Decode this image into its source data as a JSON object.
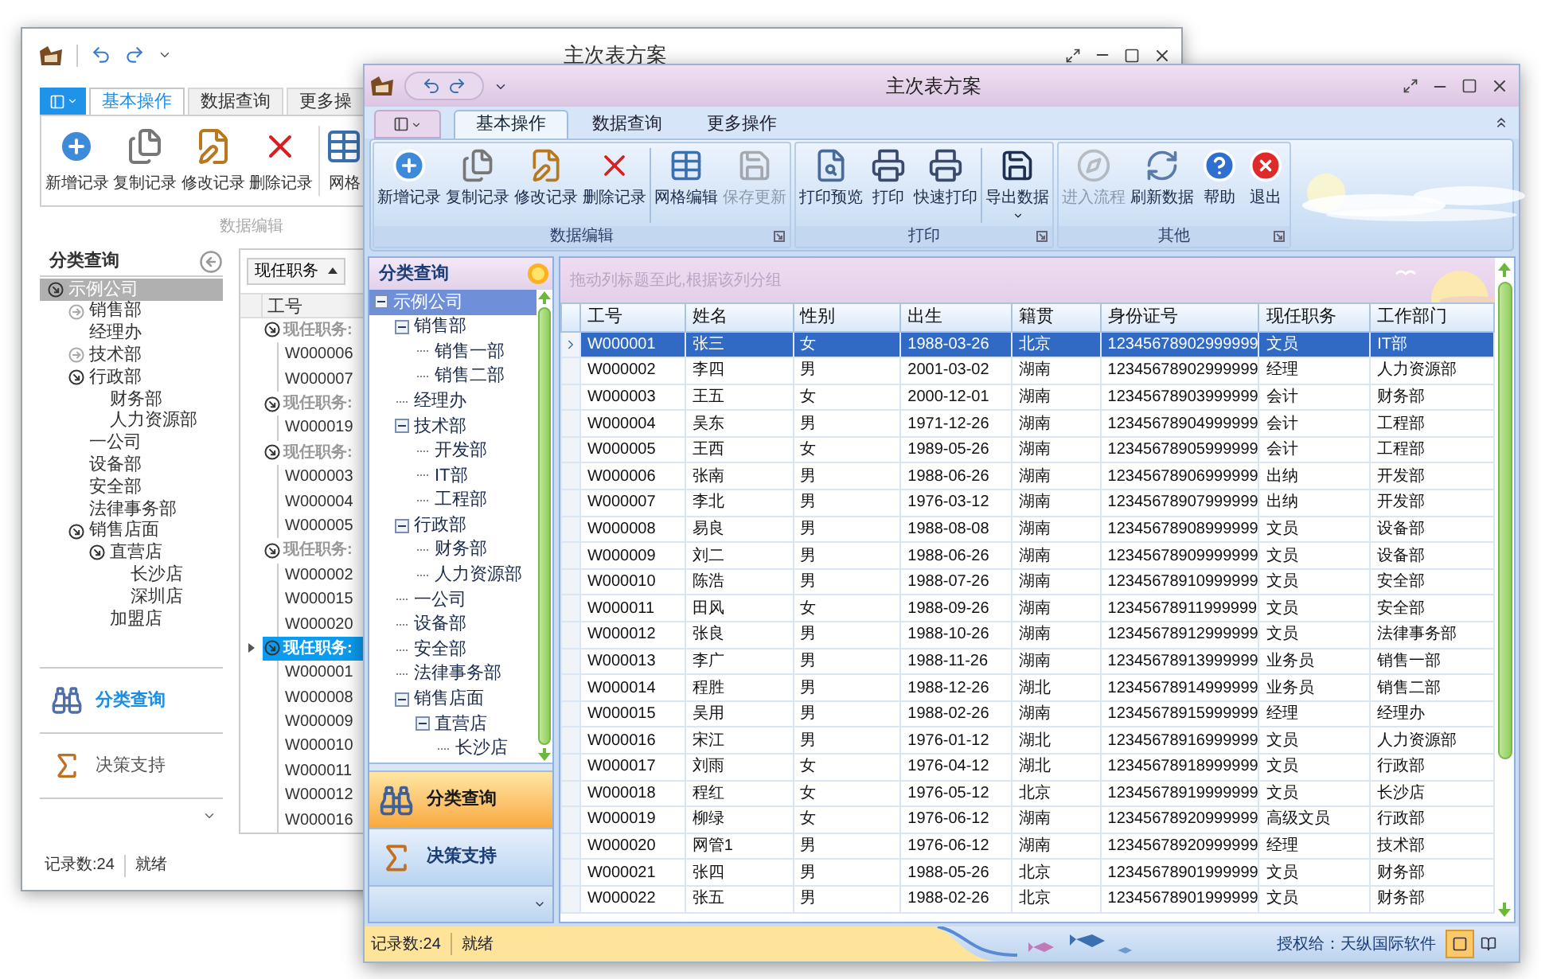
{
  "back_window": {
    "title": "主次表方案",
    "ribbon_tabs": [
      {
        "label": "基本操作",
        "selected": true
      },
      {
        "label": "数据查询",
        "selected": false
      },
      {
        "label": "更多操",
        "selected": false
      }
    ],
    "ribbon_buttons": [
      "新增记录",
      "复制记录",
      "修改记录",
      "删除记录",
      "网格"
    ],
    "ribbon_group": "数据编辑",
    "panel_title": "分类查询",
    "tree": [
      {
        "label": "示例公司",
        "selected": true,
        "expanded": true,
        "children": [
          {
            "label": "销售部",
            "selected": false,
            "expanded": false
          },
          {
            "label": "经理办",
            "selected": false
          },
          {
            "label": "技术部",
            "selected": false,
            "expanded": false
          },
          {
            "label": "行政部",
            "selected": false,
            "expanded": true,
            "children": [
              {
                "label": "财务部",
                "selected": false
              },
              {
                "label": "人力资源部",
                "selected": false
              }
            ]
          },
          {
            "label": "一公司",
            "selected": false
          },
          {
            "label": "设备部",
            "selected": false
          },
          {
            "label": "安全部",
            "selected": false
          },
          {
            "label": "法律事务部",
            "selected": false
          },
          {
            "label": "销售店面",
            "selected": false,
            "expanded": true,
            "children": [
              {
                "label": "直营店",
                "selected": false,
                "expanded": true,
                "children": [
                  {
                    "label": "长沙店",
                    "selected": false
                  },
                  {
                    "label": "深圳店",
                    "selected": false
                  }
                ]
              },
              {
                "label": "加盟店",
                "selected": false
              }
            ]
          }
        ]
      }
    ],
    "nav": [
      {
        "label": "分类查询",
        "selected": true
      },
      {
        "label": "决策支持",
        "selected": false
      }
    ],
    "group_by": "现任职务",
    "column": "工号",
    "groups": [
      {
        "label": "现任职务:",
        "selected": false,
        "expanded": true,
        "rows": [
          "W000006",
          "W000007"
        ]
      },
      {
        "label": "现任职务:",
        "selected": false,
        "expanded": true,
        "rows": [
          "W000019"
        ]
      },
      {
        "label": "现任职务:",
        "selected": false,
        "expanded": true,
        "rows": [
          "W000003",
          "W000004",
          "W000005"
        ]
      },
      {
        "label": "现任职务:",
        "selected": false,
        "expanded": true,
        "rows": [
          "W000002",
          "W000015",
          "W000020"
        ]
      },
      {
        "label": "现任职务:",
        "selected": true,
        "expanded": true,
        "rows": [
          "W000001",
          "W000008",
          "W000009",
          "W000010",
          "W000011",
          "W000012",
          "W000016"
        ]
      }
    ],
    "status": [
      "记录数:24",
      "就绪"
    ]
  },
  "front_window": {
    "title": "主次表方案",
    "ribbon_tabs": [
      {
        "label": "基本操作",
        "selected": true
      },
      {
        "label": "数据查询",
        "selected": false
      },
      {
        "label": "更多操作",
        "selected": false
      }
    ],
    "ribbon_groups": [
      {
        "label": "数据编辑",
        "buttons": [
          {
            "label": "新增记录",
            "disabled": false
          },
          {
            "label": "复制记录",
            "disabled": false
          },
          {
            "label": "修改记录",
            "disabled": false
          },
          {
            "label": "删除记录",
            "disabled": false
          },
          {
            "label": "网格编辑",
            "disabled": false,
            "separator_before": true
          },
          {
            "label": "保存更新",
            "disabled": true
          }
        ]
      },
      {
        "label": "打印",
        "buttons": [
          {
            "label": "打印预览",
            "disabled": false
          },
          {
            "label": "打印",
            "disabled": false
          },
          {
            "label": "快速打印",
            "disabled": false
          },
          {
            "label": "导出数据",
            "disabled": false,
            "separator_before": true,
            "dropdown": true
          }
        ]
      },
      {
        "label": "其他",
        "buttons": [
          {
            "label": "进入流程",
            "disabled": true
          },
          {
            "label": "刷新数据",
            "disabled": false
          },
          {
            "label": "帮助",
            "disabled": false
          },
          {
            "label": "退出",
            "disabled": false
          }
        ]
      }
    ],
    "panel_title": "分类查询",
    "tree": [
      {
        "label": "示例公司",
        "selected": true,
        "expanded": true,
        "children": [
          {
            "label": "销售部",
            "selected": false,
            "expanded": true,
            "children": [
              {
                "label": "销售一部",
                "selected": false
              },
              {
                "label": "销售二部",
                "selected": false
              }
            ]
          },
          {
            "label": "经理办",
            "selected": false
          },
          {
            "label": "技术部",
            "selected": false,
            "expanded": true,
            "children": [
              {
                "label": "开发部",
                "selected": false
              },
              {
                "label": "IT部",
                "selected": false
              },
              {
                "label": "工程部",
                "selected": false
              }
            ]
          },
          {
            "label": "行政部",
            "selected": false,
            "expanded": true,
            "children": [
              {
                "label": "财务部",
                "selected": false
              },
              {
                "label": "人力资源部",
                "selected": false
              }
            ]
          },
          {
            "label": "一公司",
            "selected": false
          },
          {
            "label": "设备部",
            "selected": false
          },
          {
            "label": "安全部",
            "selected": false
          },
          {
            "label": "法律事务部",
            "selected": false
          },
          {
            "label": "销售店面",
            "selected": false,
            "expanded": true,
            "children": [
              {
                "label": "直营店",
                "selected": false,
                "expanded": true,
                "children": [
                  {
                    "label": "长沙店",
                    "selected": false
                  }
                ]
              }
            ]
          }
        ]
      }
    ],
    "nav": [
      {
        "label": "分类查询",
        "selected": true
      },
      {
        "label": "决策支持",
        "selected": false
      }
    ],
    "group_panel": {
      "placeholder": "拖动列标题至此,根据该列分组"
    },
    "table": {
      "columns": [
        "工号",
        "姓名",
        "性别",
        "出生",
        "籍贯",
        "身份证号",
        "现任职务",
        "工作部门"
      ],
      "rows": [
        {
          "selected": true,
          "cells": [
            "W000001",
            "张三",
            "女",
            "1988-03-26",
            "北京",
            "12345678902999999",
            "文员",
            "IT部"
          ]
        },
        {
          "selected": false,
          "cells": [
            "W000002",
            "李四",
            "男",
            "2001-03-02",
            "湖南",
            "12345678902999999",
            "经理",
            "人力资源部"
          ]
        },
        {
          "selected": false,
          "cells": [
            "W000003",
            "王五",
            "女",
            "2000-12-01",
            "湖南",
            "12345678903999999",
            "会计",
            "财务部"
          ]
        },
        {
          "selected": false,
          "cells": [
            "W000004",
            "吴东",
            "男",
            "1971-12-26",
            "湖南",
            "12345678904999999",
            "会计",
            "工程部"
          ]
        },
        {
          "selected": false,
          "cells": [
            "W000005",
            "王西",
            "女",
            "1989-05-26",
            "湖南",
            "12345678905999999",
            "会计",
            "工程部"
          ]
        },
        {
          "selected": false,
          "cells": [
            "W000006",
            "张南",
            "男",
            "1988-06-26",
            "湖南",
            "12345678906999999",
            "出纳",
            "开发部"
          ]
        },
        {
          "selected": false,
          "cells": [
            "W000007",
            "李北",
            "男",
            "1976-03-12",
            "湖南",
            "12345678907999999",
            "出纳",
            "开发部"
          ]
        },
        {
          "selected": false,
          "cells": [
            "W000008",
            "易良",
            "男",
            "1988-08-08",
            "湖南",
            "12345678908999999",
            "文员",
            "设备部"
          ]
        },
        {
          "selected": false,
          "cells": [
            "W000009",
            "刘二",
            "男",
            "1988-06-26",
            "湖南",
            "12345678909999999",
            "文员",
            "设备部"
          ]
        },
        {
          "selected": false,
          "cells": [
            "W000010",
            "陈浩",
            "男",
            "1988-07-26",
            "湖南",
            "12345678910999999",
            "文员",
            "安全部"
          ]
        },
        {
          "selected": false,
          "cells": [
            "W000011",
            "田风",
            "女",
            "1988-09-26",
            "湖南",
            "12345678911999999",
            "文员",
            "安全部"
          ]
        },
        {
          "selected": false,
          "cells": [
            "W000012",
            "张良",
            "男",
            "1988-10-26",
            "湖南",
            "12345678912999999",
            "文员",
            "法律事务部"
          ]
        },
        {
          "selected": false,
          "cells": [
            "W000013",
            "李广",
            "男",
            "1988-11-26",
            "湖南",
            "12345678913999999",
            "业务员",
            "销售一部"
          ]
        },
        {
          "selected": false,
          "cells": [
            "W000014",
            "程胜",
            "男",
            "1988-12-26",
            "湖北",
            "12345678914999999",
            "业务员",
            "销售二部"
          ]
        },
        {
          "selected": false,
          "cells": [
            "W000015",
            "吴用",
            "男",
            "1988-02-26",
            "湖南",
            "12345678915999999",
            "经理",
            "经理办"
          ]
        },
        {
          "selected": false,
          "cells": [
            "W000016",
            "宋江",
            "男",
            "1976-01-12",
            "湖北",
            "12345678916999999",
            "文员",
            "人力资源部"
          ]
        },
        {
          "selected": false,
          "cells": [
            "W000017",
            "刘雨",
            "女",
            "1976-04-12",
            "湖北",
            "12345678918999999",
            "文员",
            "行政部"
          ]
        },
        {
          "selected": false,
          "cells": [
            "W000018",
            "程红",
            "女",
            "1976-05-12",
            "北京",
            "12345678919999999",
            "文员",
            "长沙店"
          ]
        },
        {
          "selected": false,
          "cells": [
            "W000019",
            "柳绿",
            "女",
            "1976-06-12",
            "湖南",
            "12345678920999999",
            "高级文员",
            "行政部"
          ]
        },
        {
          "selected": false,
          "cells": [
            "W000020",
            "网管1",
            "男",
            "1976-06-12",
            "湖南",
            "12345678920999999",
            "经理",
            "技术部"
          ]
        },
        {
          "selected": false,
          "cells": [
            "W000021",
            "张四",
            "男",
            "1988-05-26",
            "北京",
            "12345678901999999",
            "文员",
            "财务部"
          ]
        },
        {
          "selected": false,
          "cells": [
            "W000022",
            "张五",
            "男",
            "1988-02-26",
            "北京",
            "12345678901999999",
            "文员",
            "财务部"
          ]
        }
      ]
    },
    "status_bar": {
      "record_count": "记录数:24",
      "state": "就绪",
      "license": "授权给：天纵国际软件",
      "views": [
        {
          "selected": true
        },
        {
          "selected": false
        }
      ]
    }
  }
}
